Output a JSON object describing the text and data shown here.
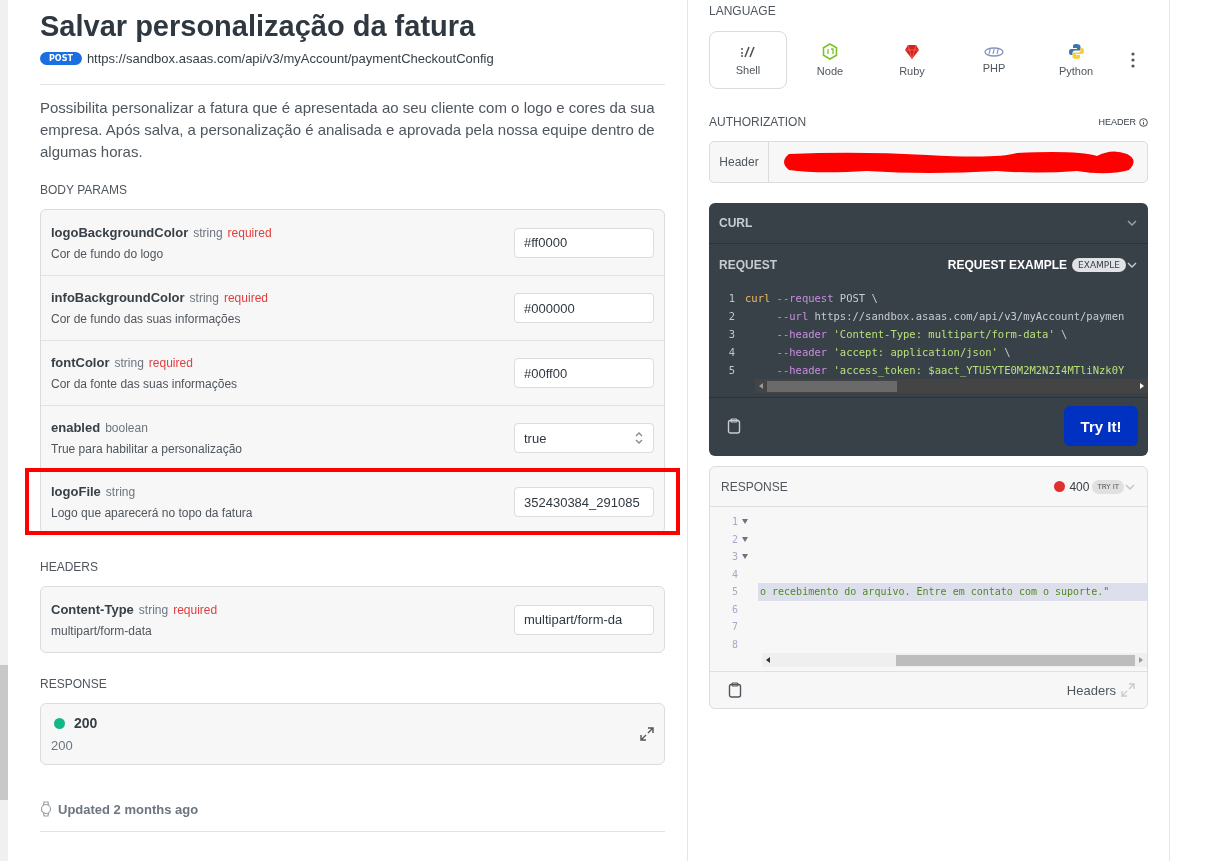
{
  "title": "Salvar personalização da fatura",
  "endpoint": {
    "method": "POST",
    "url": "https://sandbox.asaas.com/api/v3/myAccount/paymentCheckoutConfig"
  },
  "description": "Possibilita personalizar a fatura que é apresentada ao seu cliente com o logo e cores da sua empresa. Após salva, a personalização é analisada e aprovada pela nossa equipe dentro de algumas horas.",
  "body_params": {
    "heading": "BODY PARAMS",
    "params": [
      {
        "name": "logoBackgroundColor",
        "type": "string",
        "required": "required",
        "description": "Cor de fundo do logo",
        "kind": "text",
        "value": "#ff0000",
        "highlighted": false
      },
      {
        "name": "infoBackgroundColor",
        "type": "string",
        "required": "required",
        "description": "Cor de fundo das suas informações",
        "kind": "text",
        "value": "#000000",
        "highlighted": false
      },
      {
        "name": "fontColor",
        "type": "string",
        "required": "required",
        "description": "Cor da fonte das suas informações",
        "kind": "text",
        "value": "#00ff00",
        "highlighted": false
      },
      {
        "name": "enabled",
        "type": "boolean",
        "description": "True para habilitar a personalização",
        "kind": "select",
        "value": "true",
        "highlighted": false
      },
      {
        "name": "logoFile",
        "type": "string",
        "description": "Logo que aparecerá no topo da fatura",
        "kind": "text",
        "value": "352430384_291085",
        "highlighted": true
      }
    ]
  },
  "headers": {
    "heading": "HEADERS",
    "params": [
      {
        "name": "Content-Type",
        "type": "string",
        "required": "required",
        "description": "multipart/form-data",
        "kind": "text",
        "value": "multipart/form-da",
        "highlighted": false
      }
    ]
  },
  "response": {
    "heading": "RESPONSE",
    "items": [
      {
        "code": "200",
        "description": "200",
        "color": "#12b886"
      }
    ]
  },
  "updated": "Updated 2 months ago",
  "language": {
    "heading": "LANGUAGE",
    "tabs": [
      {
        "label": "Shell",
        "selected": true
      },
      {
        "label": "Node",
        "selected": false
      },
      {
        "label": "Ruby",
        "selected": false
      },
      {
        "label": "PHP",
        "selected": false
      },
      {
        "label": "Python",
        "selected": false
      }
    ]
  },
  "authorization": {
    "heading": "AUTHORIZATION",
    "type": "HEADER",
    "field_label": "Header",
    "redacted": true
  },
  "curl": {
    "heading": "CURL",
    "request_label": "REQUEST",
    "example_title": "REQUEST EXAMPLE",
    "example_badge": "EXAMPLE",
    "button": "Try It!",
    "lines": [
      {
        "number": "1",
        "parts": [
          {
            "kind": "cmd",
            "text": "curl"
          },
          {
            "kind": "flag",
            "text": " --request"
          },
          {
            "kind": "plain",
            "text": " POST \\"
          }
        ]
      },
      {
        "number": "2",
        "parts": [
          {
            "kind": "flag",
            "text": "     --url"
          },
          {
            "kind": "plain",
            "text": " https://sandbox.asaas.com/api/v3/myAccount/paymen"
          }
        ]
      },
      {
        "number": "3",
        "parts": [
          {
            "kind": "flag",
            "text": "     --header"
          },
          {
            "kind": "str",
            "text": " 'Content-Type: multipart/form-data'"
          },
          {
            "kind": "plain",
            "text": " \\"
          }
        ]
      },
      {
        "number": "4",
        "parts": [
          {
            "kind": "flag",
            "text": "     --header"
          },
          {
            "kind": "str",
            "text": " 'accept: application/json'"
          },
          {
            "kind": "plain",
            "text": " \\"
          }
        ]
      },
      {
        "number": "5",
        "parts": [
          {
            "kind": "flag",
            "text": "     --header"
          },
          {
            "kind": "str",
            "text": " 'access_token: $aact_YTU5YTE0M2M2N2I4MTliNzk0Y"
          }
        ]
      }
    ]
  },
  "response_panel": {
    "heading": "RESPONSE",
    "status": {
      "code": "400",
      "color": "#e03131"
    },
    "badge": "TRY IT",
    "footer": "Headers",
    "lines": [
      {
        "number": "1",
        "foldable": true,
        "highlighted": false
      },
      {
        "number": "2",
        "foldable": true,
        "highlighted": false
      },
      {
        "number": "3",
        "foldable": true,
        "highlighted": false
      },
      {
        "number": "4",
        "foldable": false,
        "highlighted": false
      },
      {
        "number": "5",
        "foldable": false,
        "text": "o recebimento do arquivo. Entre em contato com o suporte.\"",
        "highlighted": true
      },
      {
        "number": "6",
        "foldable": false,
        "highlighted": false
      },
      {
        "number": "7",
        "foldable": false,
        "highlighted": false
      },
      {
        "number": "8",
        "foldable": false,
        "highlighted": false
      }
    ]
  }
}
